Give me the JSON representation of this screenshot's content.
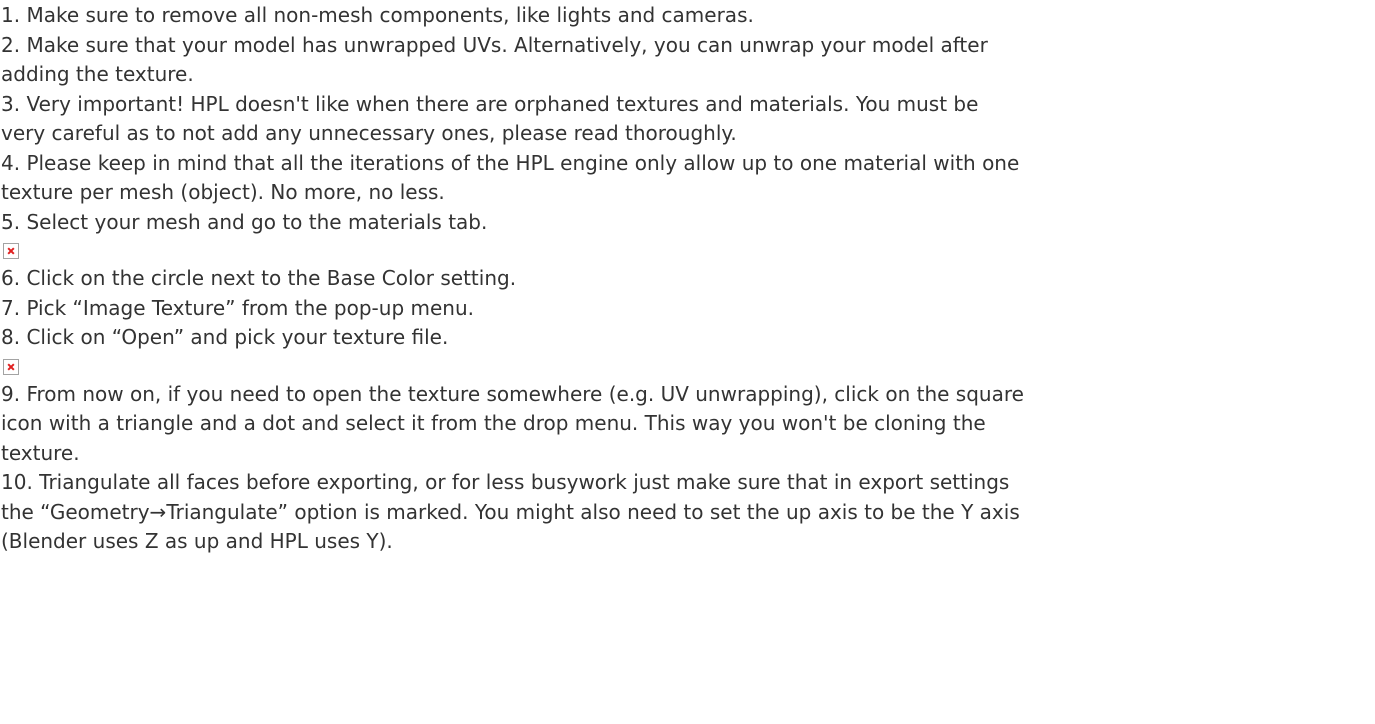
{
  "steps": [
    {
      "lines": [
        "1. Make sure to remove all non-mesh components, like lights and cameras."
      ]
    },
    {
      "lines": [
        "2. Make sure that your model has unwrapped UVs. Alternatively, you can unwrap your model after",
        "adding the texture."
      ]
    },
    {
      "lines": [
        "3. Very important! HPL doesn't like when there are orphaned textures and materials. You must be",
        "very careful as to not add any unnecessary ones, please read thoroughly."
      ]
    },
    {
      "lines": [
        "4. Please keep in mind that all the iterations of the HPL engine only allow up to one material with one",
        "texture per mesh (object). No more, no less."
      ]
    },
    {
      "lines": [
        "5. Select your mesh and go to the materials tab."
      ]
    },
    {
      "lines": [
        "6. Click on the circle next to the Base Color setting."
      ]
    },
    {
      "lines": [
        "7. Pick “Image Texture” from the pop-up menu."
      ]
    },
    {
      "lines": [
        "8. Click on “Open” and pick your texture file."
      ]
    },
    {
      "lines": [
        "9. From now on, if you need to open the texture somewhere (e.g. UV unwrapping), click on the square",
        "icon with a triangle and a dot and select it from the drop menu. This way you won't be cloning the",
        "texture."
      ]
    },
    {
      "lines": [
        "10. Triangulate all faces before exporting, or for less busywork just make sure that in export settings",
        "the “Geometry→Triangulate” option is marked. You might also need to set the up axis to be the Y axis",
        "(Blender uses Z as up and HPL uses Y)."
      ]
    }
  ]
}
